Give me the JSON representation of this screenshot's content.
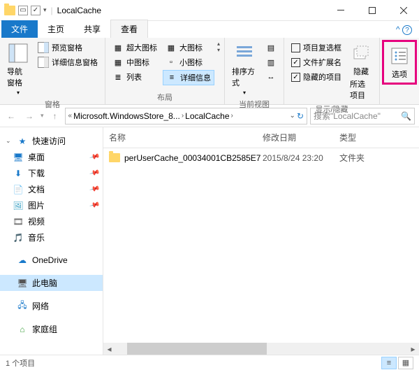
{
  "window": {
    "title": "LocalCache"
  },
  "tabs": {
    "file": "文件",
    "home": "主页",
    "share": "共享",
    "view": "查看"
  },
  "ribbon": {
    "panes": {
      "nav_pane": "导航窗格",
      "preview_pane": "预览窗格",
      "details_pane": "详细信息窗格",
      "group": "窗格"
    },
    "layout": {
      "xl": "超大图标",
      "lg": "大图标",
      "md": "中图标",
      "sm": "小图标",
      "list": "列表",
      "details": "详细信息",
      "group": "布局"
    },
    "current": {
      "sort": "排序方式",
      "group": "当前视图"
    },
    "showhide": {
      "item_check": "项目复选框",
      "ext": "文件扩展名",
      "hidden_items": "隐藏的项目",
      "hide": "隐藏",
      "selected": "所选项目",
      "group": "显示/隐藏"
    },
    "options": "选项"
  },
  "breadcrumb": {
    "seg1": "Microsoft.WindowsStore_8...",
    "seg2": "LocalCache"
  },
  "search": {
    "placeholder": "搜索\"LocalCache\""
  },
  "nav": {
    "quick": "快速访问",
    "desktop": "桌面",
    "downloads": "下载",
    "documents": "文档",
    "pictures": "图片",
    "videos": "视频",
    "music": "音乐",
    "onedrive": "OneDrive",
    "thispc": "此电脑",
    "network": "网络",
    "homegroup": "家庭组"
  },
  "columns": {
    "name": "名称",
    "date": "修改日期",
    "type": "类型"
  },
  "rows": [
    {
      "name": "perUserCache_00034001CB2585E7",
      "date": "2015/8/24 23:20",
      "type": "文件夹"
    }
  ],
  "status": {
    "count": "1 个项目"
  }
}
